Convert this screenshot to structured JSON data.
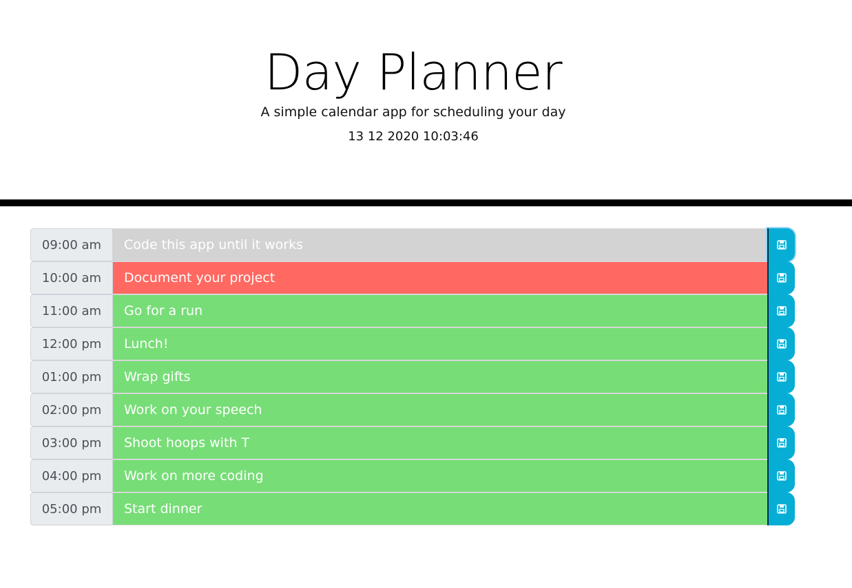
{
  "header": {
    "title": "Day Planner",
    "subtitle": "A simple calendar app for scheduling your day",
    "datetime": "13 12 2020 10:03:46"
  },
  "colors": {
    "past": "#d3d3d3",
    "present": "#ff6961",
    "future": "#77dd77",
    "save_button": "#06aed5"
  },
  "rows": [
    {
      "hour": "09:00 am",
      "task": "Code this app until it works",
      "state": "past",
      "icon": "save-icon"
    },
    {
      "hour": "10:00 am",
      "task": "Document your project",
      "state": "present",
      "icon": "save-icon"
    },
    {
      "hour": "11:00 am",
      "task": "Go for a run",
      "state": "future",
      "icon": "save-icon"
    },
    {
      "hour": "12:00 pm",
      "task": "Lunch!",
      "state": "future",
      "icon": "save-icon"
    },
    {
      "hour": "01:00 pm",
      "task": "Wrap gifts",
      "state": "future",
      "icon": "save-icon"
    },
    {
      "hour": "02:00 pm",
      "task": "Work on your speech",
      "state": "future",
      "icon": "save-icon"
    },
    {
      "hour": "03:00 pm",
      "task": "Shoot hoops with T",
      "state": "future",
      "icon": "save-icon"
    },
    {
      "hour": "04:00 pm",
      "task": "Work on more coding",
      "state": "future",
      "icon": "save-icon"
    },
    {
      "hour": "05:00 pm",
      "task": "Start dinner",
      "state": "future",
      "icon": "save-icon"
    }
  ]
}
